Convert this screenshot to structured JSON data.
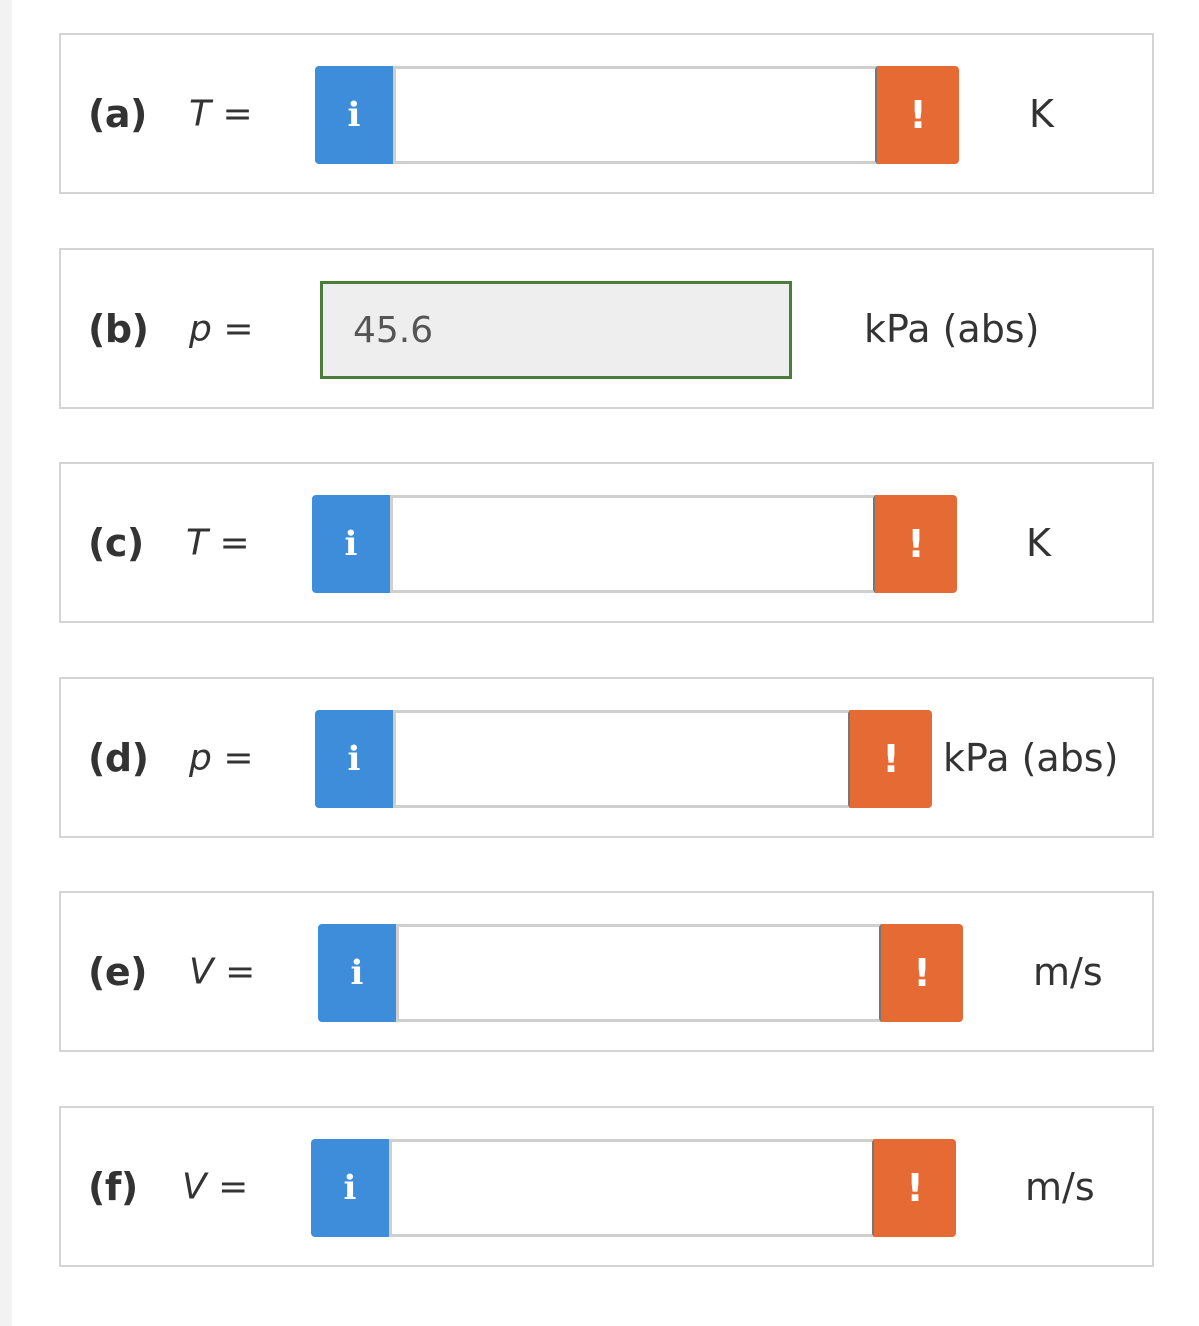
{
  "rows": [
    {
      "part": "(a)",
      "symbol": "T",
      "equals": "=",
      "info_icon": "i",
      "value": "",
      "warn_icon": "!",
      "unit": "K",
      "state": "empty"
    },
    {
      "part": "(b)",
      "symbol": "p",
      "equals": "=",
      "value": "45.6",
      "unit": "kPa (abs)",
      "state": "answered"
    },
    {
      "part": "(c)",
      "symbol": "T",
      "equals": "=",
      "info_icon": "i",
      "value": "",
      "warn_icon": "!",
      "unit": "K",
      "state": "empty"
    },
    {
      "part": "(d)",
      "symbol": "p",
      "equals": "=",
      "info_icon": "i",
      "value": "",
      "warn_icon": "!",
      "unit": "kPa (abs)",
      "state": "empty"
    },
    {
      "part": "(e)",
      "symbol": "V",
      "equals": "=",
      "info_icon": "i",
      "value": "",
      "warn_icon": "!",
      "unit": "m/s",
      "state": "empty"
    },
    {
      "part": "(f)",
      "symbol": "V",
      "equals": "=",
      "info_icon": "i",
      "value": "",
      "warn_icon": "!",
      "unit": "m/s",
      "state": "empty"
    }
  ],
  "colors": {
    "info": "#3d8ddb",
    "warning": "#e66a33",
    "answered_border": "#4a7d3a",
    "answered_bg": "#eeeeee"
  }
}
